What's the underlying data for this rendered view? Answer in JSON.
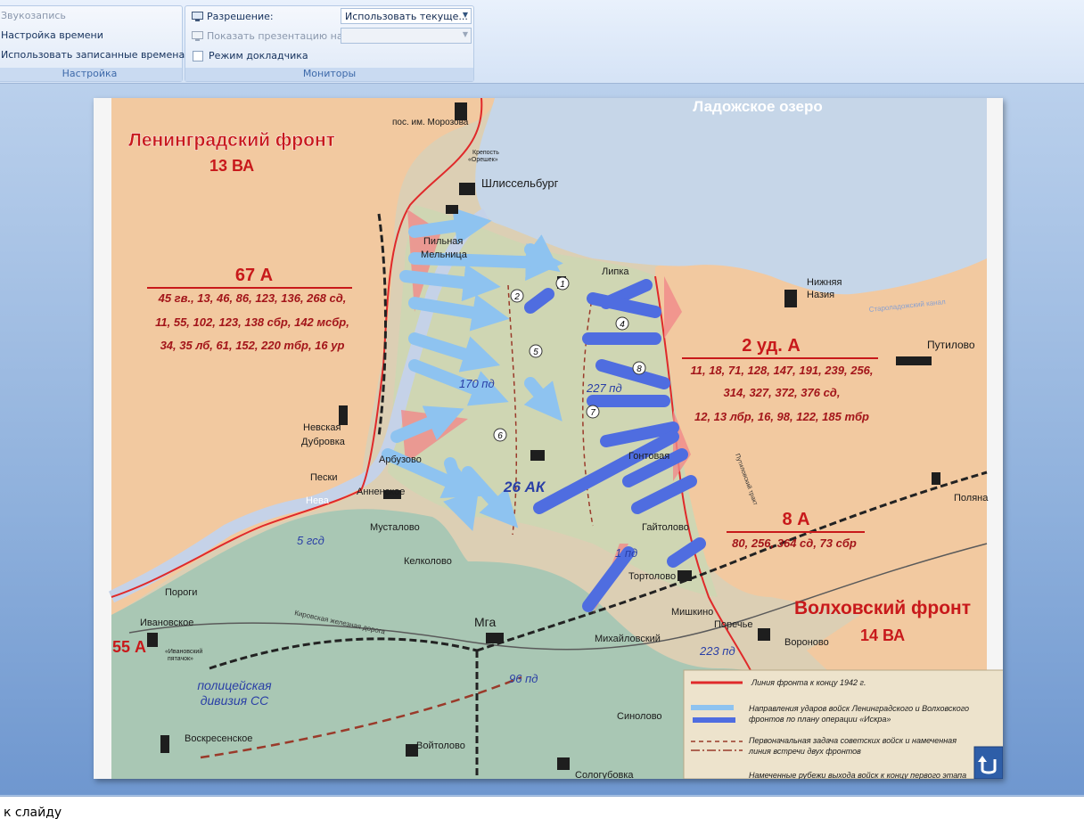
{
  "ribbon": {
    "record_narration": "Звукозапись",
    "rehearse_timings": "Настройка времени",
    "use_recorded_timings": "Использовать записанные времена",
    "setup_group": "Настройка",
    "resolution_label": "Разрешение:",
    "resolution_value": "Использовать текуще...",
    "show_on_label": "Показать презентацию на:",
    "show_on_value": "",
    "presenter_view": "Режим докладчика",
    "monitors_group": "Мониторы"
  },
  "map": {
    "lake": "Ладожское озеро",
    "leningrad_front": "Ленинградский фронт",
    "leningrad_army": "13 ВА",
    "army67": "67 А",
    "army67_units": [
      "45 гв., 13, 46, 86, 123, 136, 268 сд,",
      "11, 55, 102, 123, 138 сбр, 142 мсбр,",
      "34, 35 лб, 61, 152, 220 тбр, 16 ур"
    ],
    "army2": "2 уд. А",
    "army2_units": [
      "11, 18, 71, 128, 147, 191, 239, 256,",
      "314, 327, 372, 376 сд,",
      "12, 13 лбр, 16, 98, 122, 185 тбр"
    ],
    "army8": "8 А",
    "army8_units": "80, 256, 364 сд, 73 сбр",
    "volkhov_front": "Волховский фронт",
    "volkhov_army": "14 ВА",
    "army55": "55 А",
    "corps26": "26 АК",
    "div170": "170 пд",
    "div227": "227 пд",
    "div5": "5 гсд",
    "div96": "96 пд",
    "div223": "223 пд",
    "div1": "1 пд",
    "police_div": [
      "полицейская",
      "дивизия СС"
    ],
    "places": {
      "morozov": "пос. им. Морозова",
      "oreshek_1": "Крепость",
      "oreshek_2": "«Орешек»",
      "shlisselburg": "Шлиссельбург",
      "pilnaya": [
        "Пильная",
        "Мельница"
      ],
      "lipka": "Липка",
      "nizhnaya": [
        "Нижняя",
        "Назия"
      ],
      "putilovo": "Путилово",
      "nevskaya": [
        "Невская",
        "Дубровка"
      ],
      "peski": "Пески",
      "annenskoe": "Анненское",
      "arbuzovo": "Арбузово",
      "neva": "Нева",
      "mustolovo": "Мусталово",
      "kelkolovo": "Келколово",
      "gaitolovo": "Гайтолово",
      "tortolovo": "Тортолово",
      "mishkino": "Мишкино",
      "poreche": "Поречье",
      "voronovo": "Вороново",
      "mihailovsky": "Михайловский",
      "mga": "Мга",
      "porogi": "Пороги",
      "ivanovskoe": "Ивановское",
      "ivanovsky_pyatachok": [
        "«Ивановский",
        "пятачок»"
      ],
      "voskresenskoe": "Воскресенское",
      "voitolovo": "Войтолово",
      "sigolovo": "Синолово",
      "sologubovka": "Сологубовка",
      "polyana": "Поляна",
      "gontovaya": "Гонтовая",
      "kirov_rail": "Кировская железная дорога",
      "peat_road": "Путиловский тракт",
      "ladoga_canal": "Староладожский канал"
    },
    "circle_numbers": [
      "1",
      "2",
      "4",
      "5",
      "6",
      "7",
      "8"
    ]
  },
  "legend": {
    "front_line": "Линия фронта к концу  1942 г.",
    "strike_directions": [
      "Направления ударов войск Ленинградского и Волховского",
      "фронтов по плану операции «Искра»"
    ],
    "initial_task": [
      "Первоначальная задача советских войск и намеченная",
      "линия встречи двух фронтов"
    ],
    "planned_lines": "Намеченные рубежи выхода войск к концу первого этапа"
  },
  "nav": {
    "return_icon": "return-arrow-icon"
  },
  "notes": {
    "text": "к слайду"
  },
  "colors": {
    "leningrad_fill": "#f2c9a0",
    "enemy_fill": "#cfd6b3",
    "south_fill": "#a9c7b4",
    "lake_fill": "#c6d6e8",
    "front_line": "#e0292a",
    "arrow_light": "#8ec3f0",
    "arrow_dark": "#4f6de0",
    "title_red": "#c8191b"
  }
}
